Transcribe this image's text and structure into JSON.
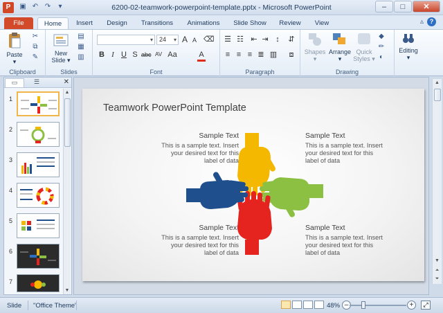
{
  "window": {
    "title": "6200-02-teamwork-powerpoint-template.pptx - Microsoft PowerPoint",
    "app_icon_letter": "P"
  },
  "tabs": [
    "File",
    "Home",
    "Insert",
    "Design",
    "Transitions",
    "Animations",
    "Slide Show",
    "Review",
    "View"
  ],
  "ribbon": {
    "clipboard": {
      "label": "Clipboard",
      "paste": "Paste"
    },
    "slides": {
      "label": "Slides",
      "new_slide_line1": "New",
      "new_slide_line2": "Slide"
    },
    "font": {
      "label": "Font",
      "size": "24"
    },
    "paragraph": {
      "label": "Paragraph"
    },
    "drawing": {
      "label": "Drawing",
      "shapes": "Shapes",
      "arrange": "Arrange",
      "quick_styles_line1": "Quick",
      "quick_styles_line2": "Styles"
    },
    "editing": {
      "label": "Editing"
    }
  },
  "slide_panel": {
    "numbers": [
      "1",
      "2",
      "3",
      "4",
      "5",
      "6",
      "7"
    ]
  },
  "slide": {
    "title": "Teamwork PowerPoint Template",
    "blocks": [
      {
        "title": "Sample Text",
        "body_lines": [
          "This is a sample text. Insert",
          "your desired text for this",
          "label of data"
        ]
      },
      {
        "title": "Sample Text",
        "body_lines": [
          "This is a sample text. Insert",
          "your desired text for this",
          "label of data"
        ]
      },
      {
        "title": "Sample Text",
        "body_lines": [
          "This is a sample text. Insert",
          "your desired text for this",
          "label of data"
        ]
      },
      {
        "title": "Sample Text",
        "body_lines": [
          "This is a sample text. Insert",
          "your desired text for this",
          "label of data"
        ]
      }
    ],
    "hand_colors": {
      "top": "#f5b800",
      "right": "#8cc043",
      "bottom": "#e52420",
      "left": "#1f4f8c"
    }
  },
  "status": {
    "slide": "Slide",
    "theme": "\"Office Theme\"",
    "zoom": "48%"
  }
}
